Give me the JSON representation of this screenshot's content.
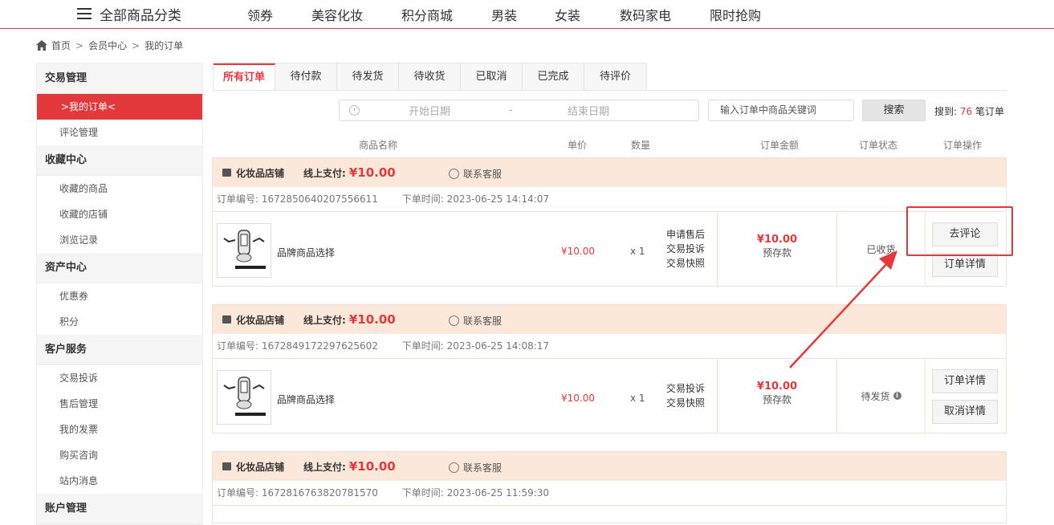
{
  "topnav": {
    "all_label": "全部商品分类",
    "links": [
      "领券",
      "美容化妆",
      "积分商城",
      "男装",
      "女装",
      "数码家电",
      "限时抢购"
    ]
  },
  "breadcrumb": [
    "首页",
    "会员中心",
    "我的订单"
  ],
  "sidebar": {
    "groups": [
      {
        "title": "交易管理",
        "items": [
          ">我的订单<",
          "评论管理"
        ]
      },
      {
        "title": "收藏中心",
        "items": [
          "收藏的商品",
          "收藏的店铺",
          "浏览记录"
        ]
      },
      {
        "title": "资产中心",
        "items": [
          "优惠券",
          "积分"
        ]
      },
      {
        "title": "客户服务",
        "items": [
          "交易投诉",
          "售后管理",
          "我的发票",
          "购买咨询",
          "站内消息"
        ]
      },
      {
        "title": "账户管理",
        "items": []
      }
    ]
  },
  "tabs": [
    "所有订单",
    "待付款",
    "待发货",
    "待收货",
    "已取消",
    "已完成",
    "待评价"
  ],
  "filter": {
    "start_placeholder": "开始日期",
    "dash": "-",
    "end_placeholder": "结束日期",
    "keyword_placeholder": "输入订单中商品关键词",
    "search_label": "搜索",
    "found_prefix": "搜到:",
    "found_count": "76",
    "found_suffix": "笔订单"
  },
  "table_headers": [
    "商品名称",
    "单价",
    "数量",
    "订单金额",
    "订单状态",
    "订单操作"
  ],
  "orders": [
    {
      "shop": "化妆品店铺",
      "pay_label": "线上支付:",
      "pay_value": "¥10.00",
      "service": "联系客服",
      "order_no": "订单编号: 1672850640207556611",
      "order_time": "下单时间: 2023-06-25 14:14:07",
      "product": "品牌商品选择",
      "price": "¥10.00",
      "qty": "x 1",
      "links": [
        "申请售后",
        "交易投诉",
        "交易快照"
      ],
      "amount": "¥10.00",
      "amount_sub": "预存款",
      "status": "已收货",
      "actions": [
        "去评论",
        "订单详情"
      ]
    },
    {
      "shop": "化妆品店铺",
      "pay_label": "线上支付:",
      "pay_value": "¥10.00",
      "service": "联系客服",
      "order_no": "订单编号: 1672849172297625602",
      "order_time": "下单时间: 2023-06-25 14:08:17",
      "product": "品牌商品选择",
      "price": "¥10.00",
      "qty": "x 1",
      "links": [
        "交易投诉",
        "交易快照"
      ],
      "amount": "¥10.00",
      "amount_sub": "预存款",
      "status": "待发货",
      "actions": [
        "订单详情",
        "取消详情"
      ]
    },
    {
      "shop": "化妆品店铺",
      "pay_label": "线上支付:",
      "pay_value": "¥10.00",
      "service": "联系客服",
      "order_no": "订单编号: 1672816763820781570",
      "order_time": "下单时间: 2023-06-25 11:59:30"
    }
  ],
  "colors": {
    "accent": "#e4393c",
    "order_header_bg": "#fbe8db"
  }
}
